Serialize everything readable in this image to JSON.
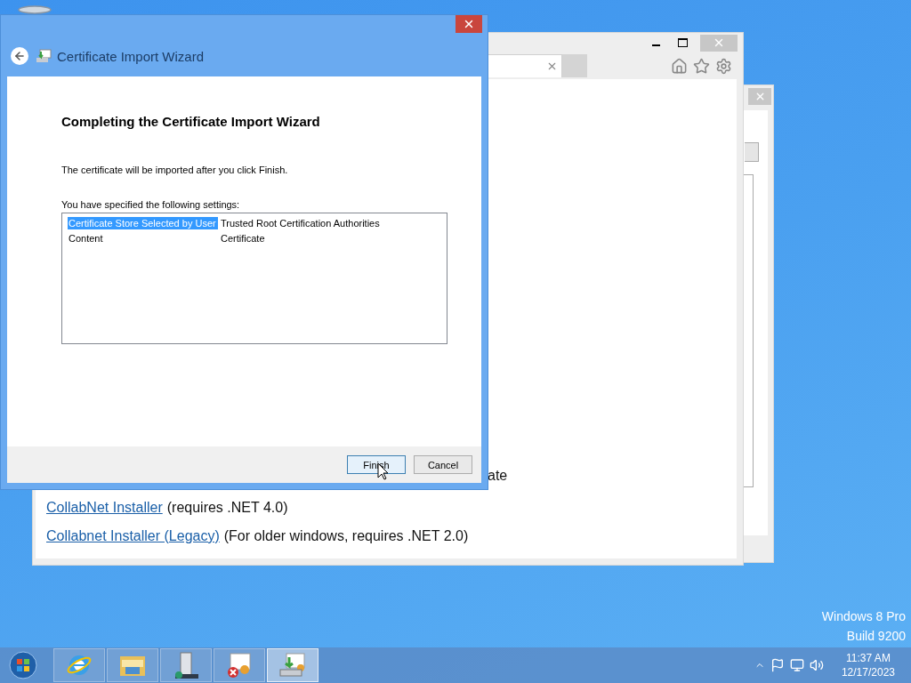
{
  "desktop": {
    "watermark": [
      "Windows 8 Pro",
      "Build 9200"
    ]
  },
  "browser": {
    "fragment": "ate",
    "links": [
      {
        "link": "CollabNet Installer",
        "note": "(requires .NET 4.0)"
      },
      {
        "link": "Collabnet Installer (Legacy)",
        "note": "(For older windows, requires .NET 2.0)"
      }
    ]
  },
  "wizard": {
    "title": "Certificate Import Wizard",
    "heading": "Completing the Certificate Import Wizard",
    "message": "The certificate will be imported after you click Finish.",
    "settings_label": "You have specified the following settings:",
    "settings": [
      {
        "name": "Certificate Store Selected by User",
        "value": "Trusted Root Certification Authorities",
        "selected": true
      },
      {
        "name": "Content",
        "value": "Certificate",
        "selected": false
      }
    ],
    "buttons": [
      {
        "label": "Finish",
        "default": true
      },
      {
        "label": "Cancel",
        "default": false
      }
    ]
  },
  "taskbar": {
    "items": [
      {
        "kind": "browser",
        "selected": false
      },
      {
        "kind": "folder",
        "selected": false
      },
      {
        "kind": "server",
        "selected": false
      },
      {
        "kind": "certificate-error",
        "selected": false
      },
      {
        "kind": "certificate-import",
        "selected": true
      }
    ],
    "clock": {
      "time": "11:37 AM",
      "date": "12/17/2023"
    }
  }
}
